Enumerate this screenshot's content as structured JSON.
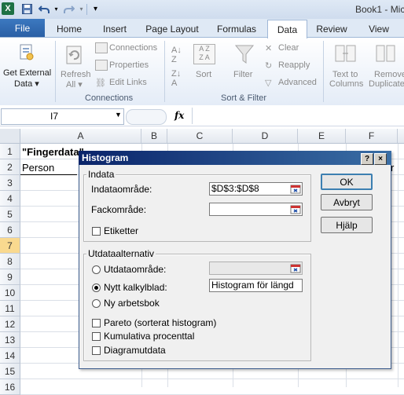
{
  "titlebar": {
    "app_title": "Book1 - Mic"
  },
  "tabs": [
    "File",
    "Home",
    "Insert",
    "Page Layout",
    "Formulas",
    "Data",
    "Review",
    "View"
  ],
  "ribbon": {
    "get_external_data": [
      "Get External",
      "Data ▾"
    ],
    "refresh": [
      "Refresh",
      "All ▾"
    ],
    "connections_items": [
      "Connections",
      "Properties",
      "Edit Links"
    ],
    "sort_az": "A↓Z",
    "sort": "Sort",
    "filter": "Filter",
    "filter_items": [
      "Clear",
      "Reapply",
      "Advanced"
    ],
    "text_to_columns": [
      "Text to",
      "Columns"
    ],
    "remove_duplicates": [
      "Remove",
      "Duplicate"
    ],
    "groups": [
      "Connections",
      "Sort & Filter"
    ]
  },
  "formula_bar": {
    "name_box": "I7",
    "fx": "fx"
  },
  "grid": {
    "columns": [
      "A",
      "B",
      "C",
      "D",
      "E",
      "F"
    ],
    "rows": [
      "1",
      "2",
      "3",
      "4",
      "5",
      "6",
      "7",
      "8",
      "9",
      "10",
      "11",
      "12",
      "13",
      "14",
      "15",
      "16"
    ],
    "selected_row": "7",
    "a1": "\"Fingerdata\"",
    "a2": "Person",
    "g2_fragment": "r"
  },
  "dialog": {
    "title": "Histogram",
    "help_btn": "?",
    "close_btn": "×",
    "input_group": "Indata",
    "input_range_label": "Indataområde:",
    "input_range_value": "$D$3:$D$8",
    "bin_range_label": "Fackområde:",
    "bin_range_value": "",
    "labels_label": "Etiketter",
    "output_group": "Utdataalternativ",
    "output_range_label": "Utdataområde:",
    "new_sheet_label": "Nytt kalkylblad:",
    "new_sheet_value": "Histogram för längd",
    "new_workbook_label": "Ny arbetsbok",
    "pareto_label": "Pareto (sorterat histogram)",
    "cumulative_label": "Kumulativa procenttal",
    "chart_label": "Diagramutdata",
    "ok": "OK",
    "cancel": "Avbryt",
    "help": "Hjälp"
  }
}
